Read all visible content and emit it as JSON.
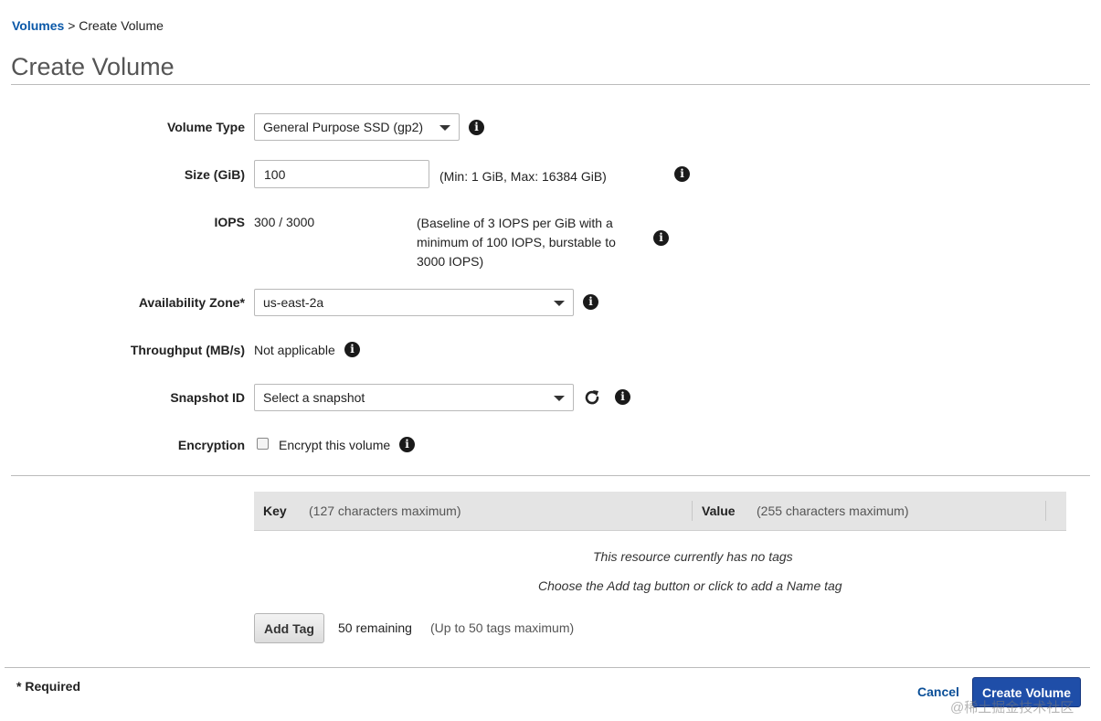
{
  "breadcrumb": {
    "root": "Volumes",
    "separator": ">",
    "current": "Create Volume"
  },
  "page_title": "Create Volume",
  "form": {
    "volume_type": {
      "label": "Volume Type",
      "value": "General Purpose SSD (gp2)"
    },
    "size": {
      "label": "Size (GiB)",
      "value": "100",
      "hint": "(Min: 1 GiB, Max: 16384 GiB)"
    },
    "iops": {
      "label": "IOPS",
      "value": "300 / 3000",
      "hint_lines": [
        "(Baseline of 3 IOPS per GiB with a",
        "minimum of 100 IOPS, burstable to",
        "3000 IOPS)"
      ]
    },
    "availability_zone": {
      "label": "Availability Zone*",
      "value": "us-east-2a"
    },
    "throughput": {
      "label": "Throughput (MB/s)",
      "value": "Not applicable"
    },
    "snapshot": {
      "label": "Snapshot ID",
      "placeholder": "Select a snapshot"
    },
    "encryption": {
      "label": "Encryption",
      "checkbox_label": "Encrypt this volume",
      "checked": false
    }
  },
  "tags": {
    "key_header": "Key",
    "key_hint": "(127 characters maximum)",
    "value_header": "Value",
    "value_hint": "(255 characters maximum)",
    "empty_message": "This resource currently has no tags",
    "hint_prefix": "Choose the Add tag button or",
    "hint_link": "click to add a Name tag",
    "add_button": "Add Tag",
    "remaining": "50 remaining",
    "limit": "(Up to 50 tags maximum)"
  },
  "footer": {
    "required_note": "* Required",
    "cancel": "Cancel",
    "create": "Create Volume"
  },
  "watermark": "@稀土掘金技术社区"
}
